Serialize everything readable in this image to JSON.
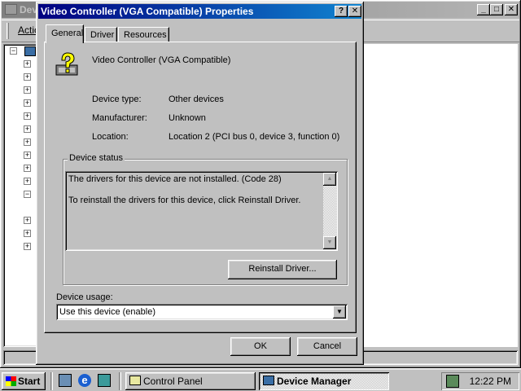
{
  "background_window": {
    "title": "Dev",
    "toolbar_action": "Actio",
    "title_buttons": [
      "_",
      "□",
      "✕"
    ]
  },
  "dialog": {
    "title": "Video Controller (VGA Compatible) Properties",
    "help_button": "?",
    "close_button": "✕",
    "tabs": [
      {
        "label": "General",
        "active": true
      },
      {
        "label": "Driver",
        "active": false
      },
      {
        "label": "Resources",
        "active": false
      }
    ],
    "device_name": "Video Controller (VGA Compatible)",
    "properties": [
      {
        "label": "Device type:",
        "value": "Other devices"
      },
      {
        "label": "Manufacturer:",
        "value": "Unknown"
      },
      {
        "label": "Location:",
        "value": "Location 2 (PCI bus 0, device 3, function 0)"
      }
    ],
    "device_status": {
      "legend": "Device status",
      "line1": "The drivers for this device are not installed. (Code 28)",
      "line2": "To reinstall the drivers for this device, click Reinstall Driver."
    },
    "reinstall_button": "Reinstall Driver...",
    "device_usage": {
      "label": "Device usage:",
      "selected": "Use this device (enable)"
    },
    "ok_button": "OK",
    "cancel_button": "Cancel"
  },
  "taskbar": {
    "start_label": "Start",
    "tasks": [
      {
        "label": "Control Panel",
        "active": false
      },
      {
        "label": "Device Manager",
        "active": true
      }
    ],
    "clock": "12:22 PM"
  },
  "icons": {
    "device_icon": "question-device-icon",
    "start_icon": "windows-flag-icon"
  }
}
